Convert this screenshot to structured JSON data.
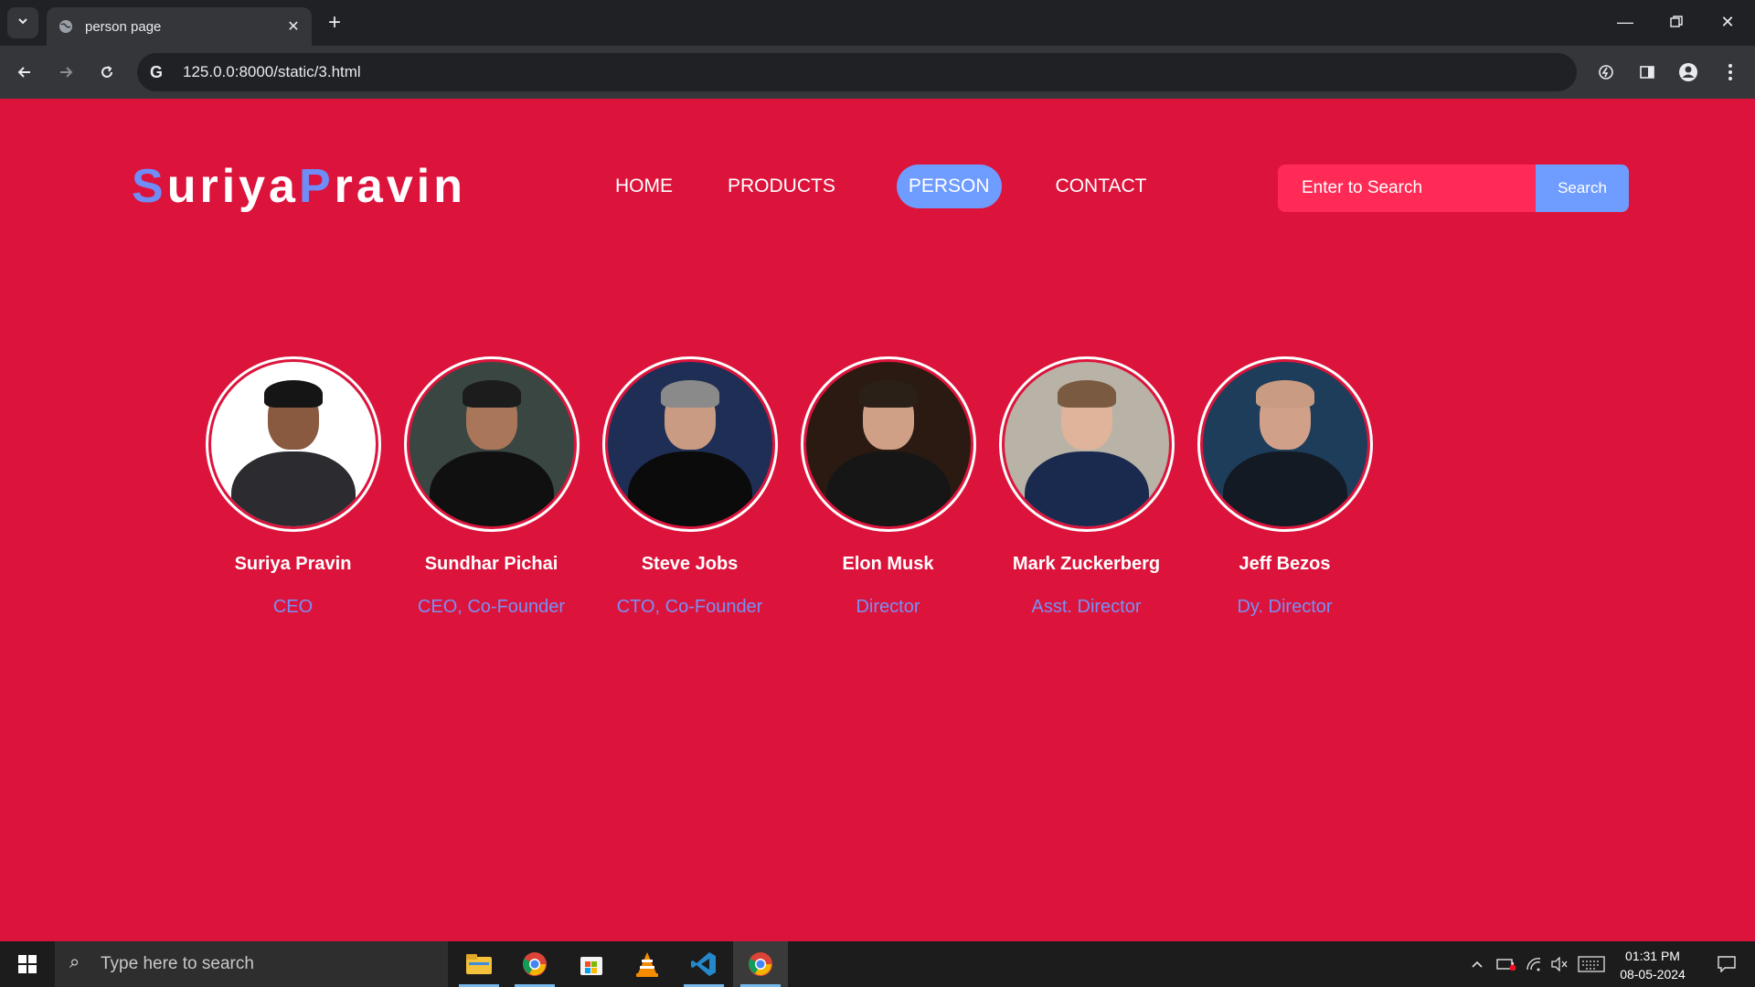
{
  "browser": {
    "tab_title": "person page",
    "address": "125.0.0:8000/static/3.html"
  },
  "site": {
    "logo_first_initial": "S",
    "logo_first_rest": "uriya",
    "logo_second_initial": "P",
    "logo_second_rest": "ravin",
    "nav": [
      {
        "label": "HOME",
        "active": false
      },
      {
        "label": "PRODUCTS",
        "active": false
      },
      {
        "label": "PERSON",
        "active": true
      },
      {
        "label": "CONTACT",
        "active": false
      }
    ],
    "search": {
      "placeholder": "Enter to Search",
      "button_label": "Search"
    },
    "colors": {
      "background": "#dc143c",
      "accent": "#6f9cff",
      "role_text": "#7a8ff2"
    }
  },
  "people": [
    {
      "name": "Suriya Pravin",
      "role": "CEO",
      "photo_bg": "#ffffff",
      "hair": "#151515",
      "suit": "#2b2b30",
      "skin": "#8a5a40"
    },
    {
      "name": "Sundhar Pichai",
      "role": "CEO, Co-Founder",
      "photo_bg": "#3a4642",
      "hair": "#1c1c1c",
      "suit": "#101010",
      "skin": "#a9765a"
    },
    {
      "name": "Steve Jobs",
      "role": "CTO, Co-Founder",
      "photo_bg": "#1f2e55",
      "hair": "#8a8a8a",
      "suit": "#0b0b0b",
      "skin": "#c99b82"
    },
    {
      "name": "Elon Musk",
      "role": "Director",
      "photo_bg": "#2a1a12",
      "hair": "#2a2017",
      "suit": "#161616",
      "skin": "#cf9f86"
    },
    {
      "name": "Mark Zuckerberg",
      "role": "Asst. Director",
      "photo_bg": "#b9b2a6",
      "hair": "#7a5a40",
      "suit": "#1a2a4f",
      "skin": "#e0b49b"
    },
    {
      "name": "Jeff Bezos",
      "role": "Dy. Director",
      "photo_bg": "#1d3d5a",
      "hair": "#c99b82",
      "suit": "#141a24",
      "skin": "#d1a088"
    }
  ],
  "taskbar": {
    "search_placeholder": "Type here to search",
    "time": "01:31 PM",
    "date": "08-05-2024"
  }
}
